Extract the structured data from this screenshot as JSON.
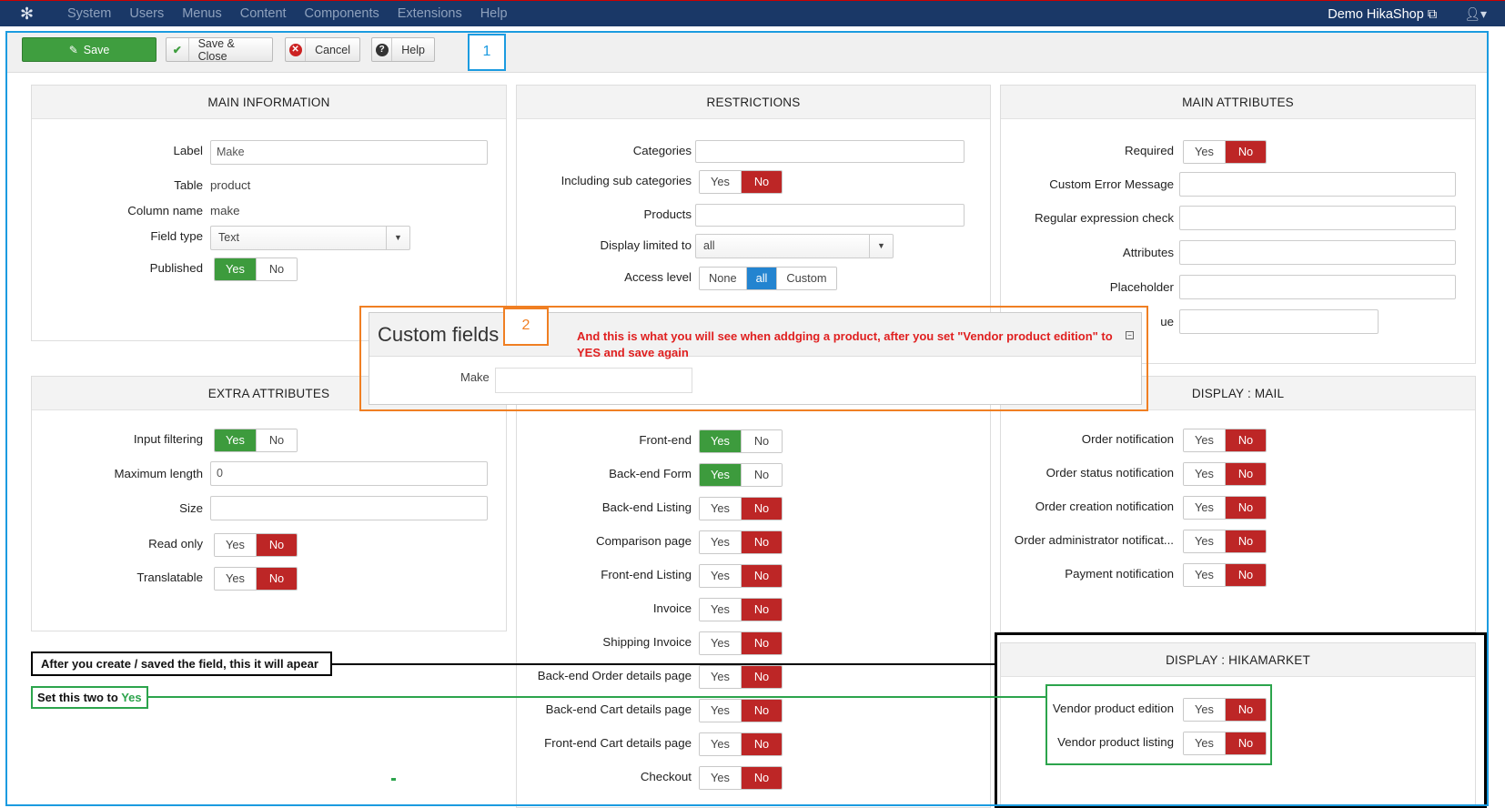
{
  "topnav": {
    "menu": [
      "System",
      "Users",
      "Menus",
      "Content",
      "Components",
      "Extensions",
      "Help"
    ],
    "site_name": "Demo HikaShop",
    "external_icon": "external-link-icon",
    "user_icon": "user-icon"
  },
  "toolbar": {
    "save": "Save",
    "save_close": "Save & Close",
    "cancel": "Cancel",
    "help": "Help"
  },
  "annotations": {
    "marker1": "1",
    "marker2": "2",
    "custom_fields_title": "Custom fields",
    "custom_fields_make": "Make",
    "added_product_note": "And this is what you will see when addging a product,  after you set \"Vendor product edition\" to YES and save again",
    "after_create_note": "After you create / saved the field, this it will apear",
    "set_two_note_prefix": "Set this two to ",
    "set_two_note_yes": "Yes"
  },
  "main_information": {
    "title": "MAIN INFORMATION",
    "label_label": "Label",
    "label_value": "Make",
    "table_label": "Table",
    "table_value": "product",
    "column_label": "Column name",
    "column_value": "make",
    "fieldtype_label": "Field type",
    "fieldtype_value": "Text",
    "published_label": "Published"
  },
  "restrictions": {
    "title": "RESTRICTIONS",
    "categories": "Categories",
    "subcats": "Including sub categories",
    "products": "Products",
    "display_limited": "Display limited to",
    "display_limited_value": "all",
    "access_level": "Access level",
    "access_options": [
      "None",
      "all",
      "Custom"
    ],
    "front_end": "Front-end",
    "backend_form": "Back-end Form",
    "backend_listing": "Back-end Listing",
    "comparison": "Comparison page",
    "frontend_listing": "Front-end Listing",
    "invoice": "Invoice",
    "shipping_invoice": "Shipping Invoice",
    "backend_order": "Back-end Order details page",
    "backend_cart": "Back-end Cart details page",
    "frontend_cart": "Front-end Cart details page",
    "checkout": "Checkout"
  },
  "main_attributes": {
    "title": "MAIN ATTRIBUTES",
    "required": "Required",
    "custom_error": "Custom Error Message",
    "regex": "Regular expression check",
    "attributes": "Attributes",
    "placeholder": "Placeholder",
    "default_value_partial": "ue"
  },
  "extra_attributes": {
    "title": "EXTRA ATTRIBUTES",
    "input_filtering": "Input filtering",
    "max_length": "Maximum length",
    "max_length_value": "0",
    "size": "Size",
    "read_only": "Read only",
    "translatable": "Translatable"
  },
  "display_mail": {
    "title": "DISPLAY : MAIL",
    "order_notification": "Order notification",
    "order_status": "Order status notification",
    "order_creation": "Order creation notification",
    "order_admin": "Order administrator notificat...",
    "payment": "Payment notification"
  },
  "display_hikamarket": {
    "title": "DISPLAY : HIKAMARKET",
    "vendor_edition": "Vendor product edition",
    "vendor_listing": "Vendor product listing"
  },
  "toggle": {
    "yes": "Yes",
    "no": "No"
  },
  "colors": {
    "green": "#3d9b3d",
    "red": "#bd2626",
    "blue": "#2384d0",
    "annotation_blue": "#1b9be0",
    "annotation_orange": "#f07f23",
    "annotation_green": "#2ca44c"
  }
}
